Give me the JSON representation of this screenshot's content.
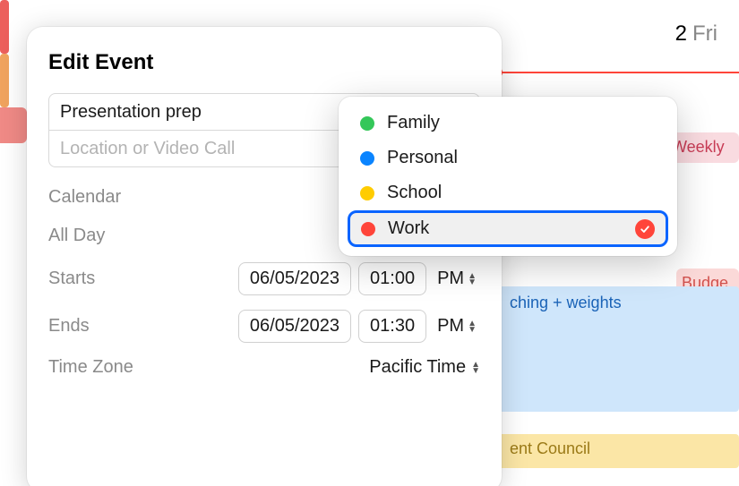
{
  "background": {
    "day_number": "2",
    "day_name": "Fri",
    "events": {
      "weekly": "Weekly",
      "stretch": "ching + weights",
      "council": "ent Council",
      "budget": "Budge"
    }
  },
  "popover": {
    "title": "Edit Event",
    "event_name": "Presentation prep",
    "location_placeholder": "Location or Video Call",
    "labels": {
      "calendar": "Calendar",
      "all_day": "All Day",
      "starts": "Starts",
      "ends": "Ends",
      "time_zone": "Time Zone"
    },
    "starts": {
      "date": "06/05/2023",
      "time": "01:00",
      "ampm": "PM"
    },
    "ends": {
      "date": "06/05/2023",
      "time": "01:30",
      "ampm": "PM"
    },
    "time_zone_value": "Pacific Time",
    "all_day_on": false
  },
  "calendar_menu": {
    "items": [
      {
        "label": "Family",
        "color": "#34c759",
        "selected": false
      },
      {
        "label": "Personal",
        "color": "#0a84ff",
        "selected": false
      },
      {
        "label": "School",
        "color": "#ffcc00",
        "selected": false
      },
      {
        "label": "Work",
        "color": "#ff453a",
        "selected": true
      }
    ]
  }
}
